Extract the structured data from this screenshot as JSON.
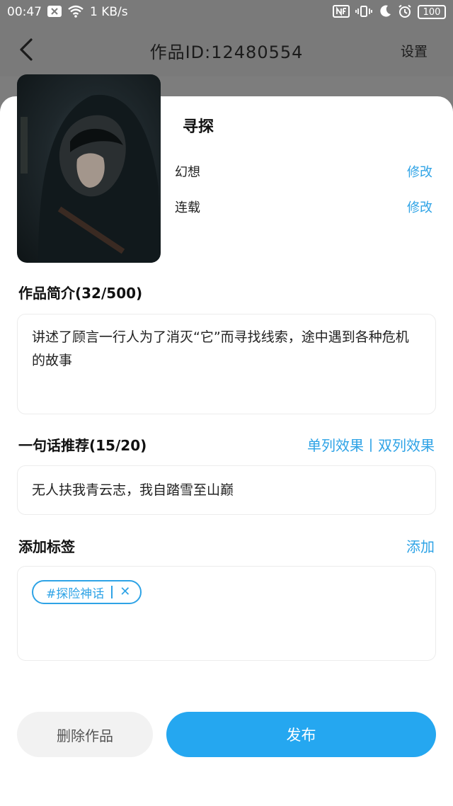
{
  "status_bar": {
    "time": "00:47",
    "network_speed": "1 KB/s",
    "battery": "100",
    "left_icons": [
      "notification-x-icon",
      "wifi-icon"
    ],
    "right_icons": [
      "nfc-icon",
      "vibrate-icon",
      "moon-icon",
      "alarm-icon"
    ]
  },
  "header": {
    "title": "作品ID:12480554",
    "settings": "设置",
    "back_icon": "chevron-left-icon"
  },
  "work": {
    "name": "寻探",
    "genre": "幻想",
    "genre_edit": "修改",
    "status": "连载",
    "status_edit": "修改"
  },
  "intro": {
    "title": "作品简介(32/500)",
    "text": "讲述了顾言一行人为了消灭“它”而寻找线索，途中遇到各种危机的故事"
  },
  "recommend": {
    "title": "一句话推荐(15/20)",
    "effects": "单列效果丨双列效果",
    "text": "无人扶我青云志，我自踏雪至山巅"
  },
  "tags": {
    "title": "添加标签",
    "add": "添加",
    "items": [
      {
        "label": "#探险神话",
        "remove": "✕"
      }
    ]
  },
  "actions": {
    "delete": "删除作品",
    "publish": "发布"
  },
  "colors": {
    "accent": "#2ea3e6",
    "publish_bg": "#25a7f0",
    "overlay": "#7d7d7d"
  }
}
